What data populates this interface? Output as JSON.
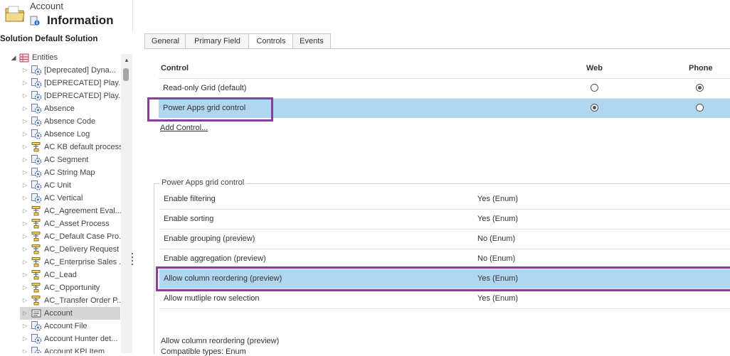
{
  "header": {
    "entity": "Account",
    "title": "Information"
  },
  "solution_title": "Solution Default Solution",
  "tree": {
    "root": "Entities",
    "items": [
      {
        "label": "[Deprecated] Dyna...",
        "icon": "entity-gear-icon"
      },
      {
        "label": "[DEPRECATED] Play...",
        "icon": "entity-gear-icon"
      },
      {
        "label": "[DEPRECATED] Play...",
        "icon": "entity-gear-icon"
      },
      {
        "label": "Absence",
        "icon": "entity-gear-icon"
      },
      {
        "label": "Absence Code",
        "icon": "entity-gear-icon"
      },
      {
        "label": "Absence Log",
        "icon": "entity-gear-icon"
      },
      {
        "label": "AC KB default process",
        "icon": "process-icon"
      },
      {
        "label": "AC Segment",
        "icon": "entity-gear-icon"
      },
      {
        "label": "AC String Map",
        "icon": "entity-gear-icon"
      },
      {
        "label": "AC Unit",
        "icon": "entity-gear-icon"
      },
      {
        "label": "AC Vertical",
        "icon": "entity-gear-icon"
      },
      {
        "label": "AC_Agreement Eval...",
        "icon": "process-icon"
      },
      {
        "label": "AC_Asset Process",
        "icon": "process-icon"
      },
      {
        "label": "AC_Default Case Pro...",
        "icon": "process-icon"
      },
      {
        "label": "AC_Delivery Request",
        "icon": "process-icon"
      },
      {
        "label": "AC_Enterprise Sales ...",
        "icon": "process-icon"
      },
      {
        "label": "AC_Lead",
        "icon": "process-icon"
      },
      {
        "label": "AC_Opportunity",
        "icon": "process-icon"
      },
      {
        "label": "AC_Transfer Order P...",
        "icon": "process-icon"
      },
      {
        "label": "Account",
        "icon": "account-icon",
        "selected": true
      },
      {
        "label": "Account File",
        "icon": "entity-gear-icon"
      },
      {
        "label": "Account Hunter det...",
        "icon": "entity-gear-icon"
      },
      {
        "label": "Account KPI Item",
        "icon": "entity-gear-icon"
      }
    ]
  },
  "tabs": [
    {
      "label": "General",
      "active": false
    },
    {
      "label": "Primary Field",
      "active": false
    },
    {
      "label": "Controls",
      "active": true
    },
    {
      "label": "Events",
      "active": false
    }
  ],
  "controls": {
    "headers": {
      "control": "Control",
      "web": "Web",
      "phone": "Phone"
    },
    "rows": [
      {
        "name": "Read-only Grid (default)",
        "web": false,
        "phone": true,
        "selected": false
      },
      {
        "name": "Power Apps grid control",
        "web": true,
        "phone": false,
        "selected": true
      }
    ],
    "add_link": "Add Control..."
  },
  "properties": {
    "title": "Power Apps grid control",
    "rows": [
      {
        "name": "Enable filtering",
        "value": "Yes (Enum)",
        "selected": false
      },
      {
        "name": "Enable sorting",
        "value": "Yes (Enum)",
        "selected": false
      },
      {
        "name": "Enable grouping (preview)",
        "value": "No (Enum)",
        "selected": false
      },
      {
        "name": "Enable aggregation (preview)",
        "value": "No (Enum)",
        "selected": false
      },
      {
        "name": "Allow column reordering (preview)",
        "value": "Yes (Enum)",
        "selected": true
      },
      {
        "name": "Allow mutliple row selection",
        "value": "Yes (Enum)",
        "selected": false
      }
    ]
  },
  "description": {
    "title": "Allow column reordering (preview)",
    "types": "Compatible types: Enum"
  },
  "colors": {
    "selection": "#b1d6f0",
    "highlight_border": "#8a3d9a",
    "tree_selected": "#d7d7d7"
  }
}
